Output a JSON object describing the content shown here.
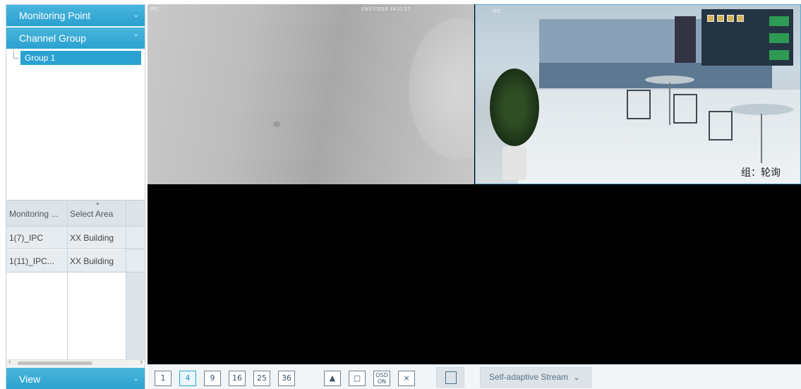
{
  "sidebar": {
    "monitoring_point": {
      "label": "Monitoring Point"
    },
    "channel_group": {
      "label": "Channel Group"
    },
    "groups": [
      {
        "label": "Group 1"
      }
    ],
    "table": {
      "headers": [
        "Monitoring ...",
        "Select Area"
      ],
      "rows": [
        {
          "monitoring": "1(7)_IPC",
          "area": "XX Building"
        },
        {
          "monitoring": "1(11)_IPC...",
          "area": "XX Building"
        }
      ]
    },
    "view": {
      "label": "View"
    }
  },
  "panes": [
    {
      "label": "IPC",
      "timestamp": "03/17/2016 14:11:27"
    },
    {
      "label": "IPC",
      "osd_text": "组：轮询"
    },
    {
      "label": ""
    },
    {
      "label": ""
    }
  ],
  "toolbar": {
    "layout_buttons": [
      "1",
      "4",
      "9",
      "16",
      "25",
      "36"
    ],
    "active_layout": "4",
    "osd_label_top": "OSD",
    "osd_label_bottom": "ON",
    "stream_label": "Self-adaptive Stream"
  },
  "colors": {
    "accent": "#2aa2d2",
    "header_gradient_top": "#49b6dc"
  },
  "icons": [
    "chevron-down-icon",
    "chevron-up-icon",
    "sequence-play-icon",
    "fullscreen-icon",
    "close-all-icon",
    "split-screen-icon"
  ]
}
